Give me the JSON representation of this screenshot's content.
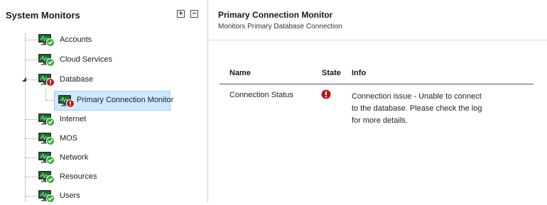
{
  "left_panel": {
    "title": "System Monitors",
    "expand_all": "+",
    "collapse_all": "−",
    "tree": [
      {
        "label": "Accounts",
        "status": "ok"
      },
      {
        "label": "Cloud Services",
        "status": "ok"
      },
      {
        "label": "Database",
        "status": "error",
        "expanded": true,
        "children": [
          {
            "label": "Primary Connection Monitor",
            "status": "error",
            "selected": true
          }
        ]
      },
      {
        "label": "Internet",
        "status": "ok"
      },
      {
        "label": "MOS",
        "status": "ok"
      },
      {
        "label": "Network",
        "status": "ok"
      },
      {
        "label": "Resources",
        "status": "ok"
      },
      {
        "label": "Users",
        "status": "ok"
      }
    ]
  },
  "detail": {
    "title": "Primary Connection Monitor",
    "subtitle": "Monitors Primary Database Connection",
    "columns": [
      "Name",
      "State",
      "Info"
    ],
    "rows": [
      {
        "name": "Connection Status",
        "state": "error",
        "info": "Connection issue - Unable to connect to the database. Please check the log for more details."
      }
    ]
  },
  "colors": {
    "ok_badge": "#3aa935",
    "error_badge": "#c0141b",
    "selection_bg": "#cde8ff",
    "selection_border": "#99d1ff",
    "monitor_screen": "#1f6e3a"
  },
  "icons": {
    "monitor": "monitor-icon",
    "ok": "checkmark-badge-icon",
    "error": "error-badge-icon",
    "expanded_arrow": "expanded-arrow-icon"
  }
}
